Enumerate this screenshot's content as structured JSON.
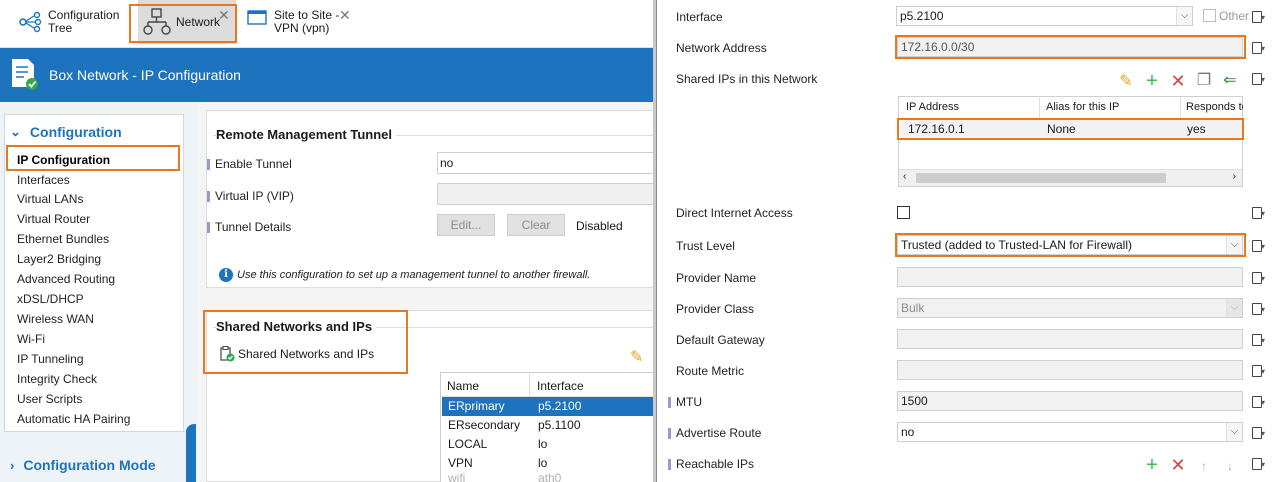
{
  "tabs": [
    {
      "label": "Configuration\nTree",
      "icon": "tree-icon"
    },
    {
      "label": "Network",
      "icon": "network-icon"
    },
    {
      "label": "Site to Site -\nVPN (vpn)",
      "icon": "vpn-window-icon"
    }
  ],
  "header": {
    "title": "Box Network - IP Configuration"
  },
  "sidebar": {
    "section_configuration": "Configuration",
    "section_mode": "Configuration Mode",
    "items": [
      "IP Configuration",
      "Interfaces",
      "Virtual LANs",
      "Virtual Router",
      "Ethernet Bundles",
      "Layer2 Bridging",
      "Advanced Routing",
      "xDSL/DHCP",
      "Wireless WAN",
      "Wi-Fi",
      "IP Tunneling",
      "Integrity Check",
      "User Scripts",
      "Automatic HA Pairing"
    ]
  },
  "rmt": {
    "title": "Remote Management Tunnel",
    "enable_label": "Enable Tunnel",
    "enable_value": "no",
    "vip_label": "Virtual IP (VIP)",
    "vip_value": "",
    "details_label": "Tunnel Details",
    "edit_btn": "Edit...",
    "clear_btn": "Clear",
    "status": "Disabled",
    "note": "Use this configuration to set up a management tunnel to another firewall."
  },
  "shared": {
    "title": "Shared Networks and IPs",
    "link": "Shared Networks and IPs",
    "columns": [
      "Name",
      "Interface"
    ],
    "rows": [
      {
        "name": "ERprimary",
        "iface": "p5.2100"
      },
      {
        "name": "ERsecondary",
        "iface": "p5.1100"
      },
      {
        "name": "LOCAL",
        "iface": "lo"
      },
      {
        "name": "VPN",
        "iface": "lo"
      },
      {
        "name": "wifi",
        "iface": "ath0"
      }
    ]
  },
  "dialog": {
    "interface_label": "Interface",
    "interface_value": "p5.2100",
    "other_label": "Other",
    "netaddr_label": "Network Address",
    "netaddr_value": "172.16.0.0/30",
    "shared_ips_label": "Shared IPs in this Network",
    "grid_columns": [
      "IP Address",
      "Alias for this IP",
      "Responds to"
    ],
    "grid_row": {
      "ip": "172.16.0.1",
      "alias": "None",
      "responds": "yes"
    },
    "direct_label": "Direct Internet Access",
    "trust_label": "Trust Level",
    "trust_value": "Trusted (added to Trusted-LAN for Firewall)",
    "provider_name_label": "Provider Name",
    "provider_name_value": "",
    "provider_class_label": "Provider Class",
    "provider_class_value": "Bulk",
    "gateway_label": "Default Gateway",
    "gateway_value": "",
    "metric_label": "Route Metric",
    "metric_value": "",
    "mtu_label": "MTU",
    "mtu_value": "1500",
    "advertise_label": "Advertise Route",
    "advertise_value": "no",
    "reachable_label": "Reachable IPs"
  },
  "colors": {
    "accent": "#1e73be",
    "highlight": "#e87722",
    "selection": "#1e73be"
  }
}
